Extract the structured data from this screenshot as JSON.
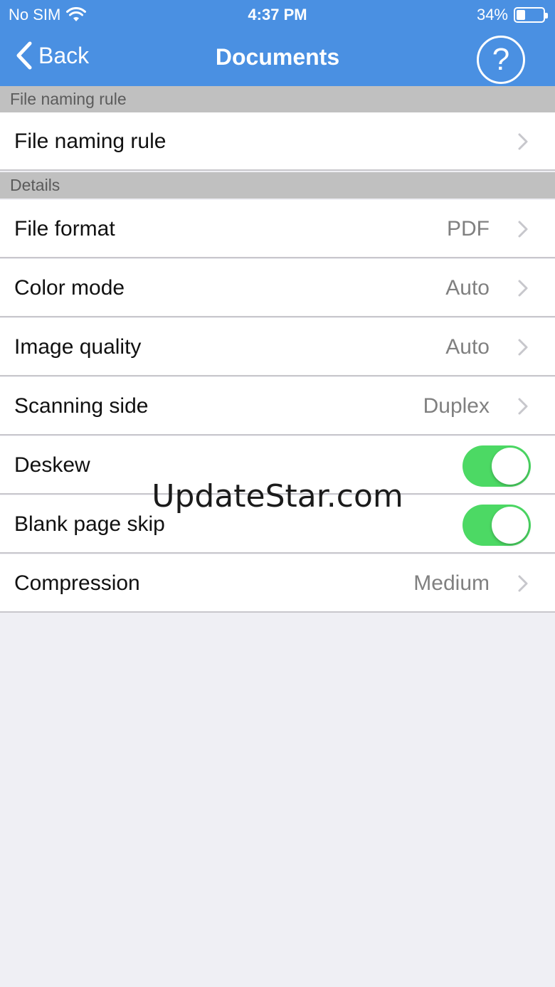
{
  "status_bar": {
    "carrier": "No SIM",
    "time": "4:37 PM",
    "battery": "34%"
  },
  "nav": {
    "back_label": "Back",
    "title": "Documents",
    "help_symbol": "?"
  },
  "sections": {
    "naming_header": "File naming rule",
    "details_header": "Details"
  },
  "rows": {
    "file_naming_rule": {
      "label": "File naming rule"
    },
    "file_format": {
      "label": "File format",
      "value": "PDF"
    },
    "color_mode": {
      "label": "Color mode",
      "value": "Auto"
    },
    "image_quality": {
      "label": "Image quality",
      "value": "Auto"
    },
    "scanning_side": {
      "label": "Scanning side",
      "value": "Duplex"
    },
    "deskew": {
      "label": "Deskew",
      "on": true
    },
    "blank_page_skip": {
      "label": "Blank page skip",
      "on": true
    },
    "compression": {
      "label": "Compression",
      "value": "Medium"
    }
  },
  "watermark": "UpdateStar.com",
  "colors": {
    "nav_blue": "#4a90e2",
    "toggle_green": "#4cd964",
    "section_gray": "#c0c0c0",
    "background": "#efeff4"
  }
}
